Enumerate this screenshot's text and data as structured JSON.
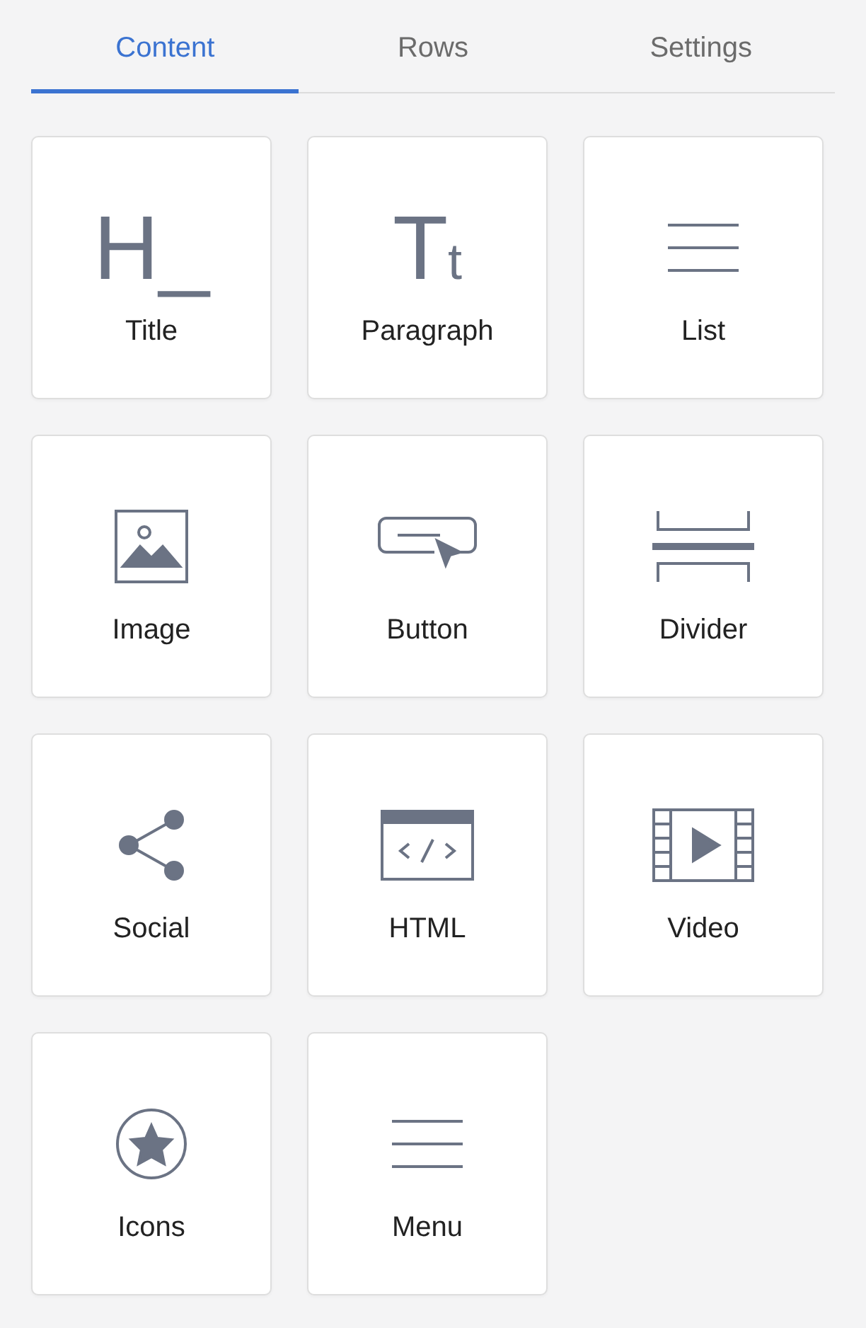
{
  "tabs": [
    {
      "label": "Content",
      "selected": true
    },
    {
      "label": "Rows",
      "selected": false
    },
    {
      "label": "Settings",
      "selected": false
    }
  ],
  "blocks": [
    {
      "kind": "title",
      "glyph": "H_",
      "label": "Title"
    },
    {
      "kind": "paragraph",
      "glyph": "Tt",
      "label": "Paragraph"
    },
    {
      "kind": "list",
      "label": "List"
    },
    {
      "kind": "image",
      "label": "Image"
    },
    {
      "kind": "button",
      "label": "Button"
    },
    {
      "kind": "divider",
      "label": "Divider"
    },
    {
      "kind": "social",
      "label": "Social"
    },
    {
      "kind": "html",
      "label": "HTML"
    },
    {
      "kind": "video",
      "label": "Video"
    },
    {
      "kind": "icons",
      "label": "Icons"
    },
    {
      "kind": "menu",
      "label": "Menu"
    }
  ]
}
